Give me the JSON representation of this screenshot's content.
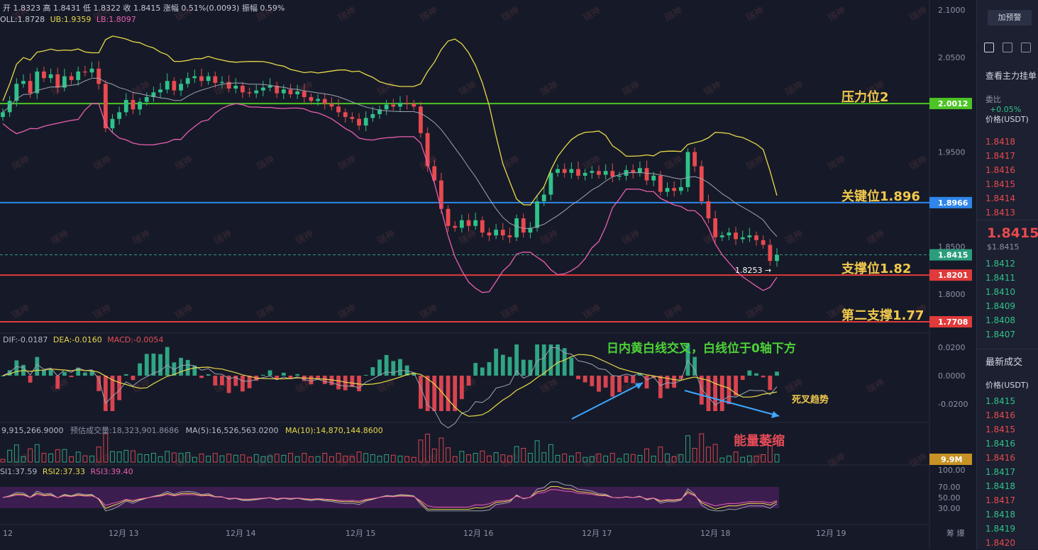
{
  "header": {
    "ohlc_text": "开 1.8323  高 1.8431  低 1.8322  收 1.8415  涨幅 0.51%(0.0093)  振幅 0.59%",
    "boll_label": "OLL:1.8728",
    "ub_label": "UB:1.9359",
    "lb_label": "LB:1.8097"
  },
  "macd_header": {
    "dif": "DIF:-0.0187",
    "dea": "DEA:-0.0160",
    "macd": "MACD:-0.0054"
  },
  "volume_header": {
    "vol": "9,915,266.9000",
    "pred": "预估成交量:18,323,901.8686",
    "ma5": "MA(5):16,526,563.0200",
    "ma10": "MA(10):14,870,144.8600"
  },
  "rsi_header": {
    "rsi1": "SI1:37.59",
    "rsi2": "RSI2:37.33",
    "rsi3": "RSI3:39.40"
  },
  "annotations": {
    "pressure2": "压力位2",
    "key_level": "关键位1.896",
    "support": "支撑位1.82",
    "support2": "第二支撑1.77",
    "macd_note": "日内黄白线交叉，白线位于0轴下方",
    "death_cross": "死叉趋势",
    "volume_note": "能量萎缩",
    "low_marker": "1.8253",
    "watermark": "瑞神"
  },
  "price_axis": {
    "ticks": [
      "2.1000",
      "2.0500",
      "1.9500",
      "1.8500",
      "1.8000"
    ],
    "tags": [
      {
        "label": "2.0012",
        "color": "#4cc425"
      },
      {
        "label": "1.8966",
        "color": "#2f86eb"
      },
      {
        "label": "1.8415",
        "color": "#2a9d7c"
      },
      {
        "label": "1.8201",
        "color": "#e03a3a"
      },
      {
        "label": "1.7708",
        "color": "#e03a3a"
      }
    ]
  },
  "macd_axis": {
    "ticks": [
      "0.0200",
      "0.0000",
      "-0.0200"
    ]
  },
  "volume_axis": {
    "tag": "9.9M"
  },
  "rsi_axis": {
    "ticks": [
      "100.00",
      "70.00",
      "50.00",
      "30.00"
    ]
  },
  "time_axis": {
    "labels": [
      "12",
      "12月 13",
      "12月 14",
      "12月 15",
      "12月 16",
      "12月 17",
      "12月 18",
      "12月 19"
    ],
    "corner": "筹 爆"
  },
  "right_panel": {
    "alert_button": "加预警",
    "orderbook_title": "查看主力挂单",
    "ratio_label": "委比",
    "ratio_value": "+0.05%",
    "price_header": "价格(USDT)",
    "asks": [
      "1.8418",
      "1.8417",
      "1.8416",
      "1.8415",
      "1.8414",
      "1.8413"
    ],
    "last_price": "1.8415",
    "last_price_sub": "$1.8415",
    "bids": [
      "1.8412",
      "1.8411",
      "1.8410",
      "1.8409",
      "1.8408",
      "1.8407"
    ],
    "trades_title": "最新成交",
    "trades_header": "价格(USDT)",
    "trades": [
      "1.8415",
      "1.8416",
      "1.8415",
      "1.8416",
      "1.8416",
      "1.8417",
      "1.8418",
      "1.8417",
      "1.8418",
      "1.8419",
      "1.8420"
    ]
  },
  "chart_data": {
    "type": "candlestick",
    "main_axis": {
      "ylim": [
        1.75,
        2.11
      ]
    },
    "horizontal_levels": [
      {
        "value": 2.0012,
        "color": "#4cc425"
      },
      {
        "value": 1.8966,
        "color": "#2f86eb"
      },
      {
        "value": 1.8201,
        "color": "#e03a3a"
      },
      {
        "value": 1.7708,
        "color": "#e03a3a"
      }
    ],
    "current_price": 1.8415,
    "candles_close": [
      1.992,
      2.004,
      2.022,
      2.025,
      2.012,
      2.035,
      2.028,
      2.032,
      2.018,
      2.03,
      2.026,
      2.035,
      2.034,
      2.038,
      2.022,
      1.975,
      1.985,
      1.992,
      2.005,
      1.995,
      2.003,
      2.008,
      2.013,
      2.016,
      2.025,
      2.015,
      2.022,
      2.028,
      2.03,
      2.025,
      2.03,
      2.023,
      2.024,
      2.017,
      2.02,
      2.013,
      2.012,
      2.015,
      2.018,
      2.02,
      2.012,
      2.016,
      2.011,
      2.014,
      2.008,
      2.004,
      2.006,
      2.001,
      1.998,
      1.992,
      1.987,
      1.985,
      1.978,
      1.986,
      1.99,
      1.995,
      2.0,
      1.998,
      2.002,
      2.001,
      1.998,
      1.97,
      1.935,
      1.92,
      1.89,
      1.872,
      1.87,
      1.878,
      1.872,
      1.878,
      1.865,
      1.862,
      1.868,
      1.862,
      1.86,
      1.88,
      1.865,
      1.87,
      1.898,
      1.905,
      1.928,
      1.932,
      1.928,
      1.932,
      1.925,
      1.928,
      1.93,
      1.926,
      1.93,
      1.924,
      1.925,
      1.931,
      1.928,
      1.933,
      1.92,
      1.925,
      1.908,
      1.912,
      1.909,
      1.913,
      1.95,
      1.935,
      1.898,
      1.88,
      1.86,
      1.862,
      1.865,
      1.858,
      1.86,
      1.862,
      1.857,
      1.852,
      1.835,
      1.8415
    ],
    "macd_axis": {
      "ylim": [
        -0.03,
        0.03
      ]
    },
    "macd": {
      "dif": -0.0187,
      "dea": -0.016,
      "hist": -0.0054
    },
    "volume_ma": {
      "ma5": 16526563.02,
      "ma10": 14870144.86
    },
    "rsi": {
      "rsi1": 37.59,
      "rsi2": 37.33,
      "rsi3": 39.4
    }
  }
}
